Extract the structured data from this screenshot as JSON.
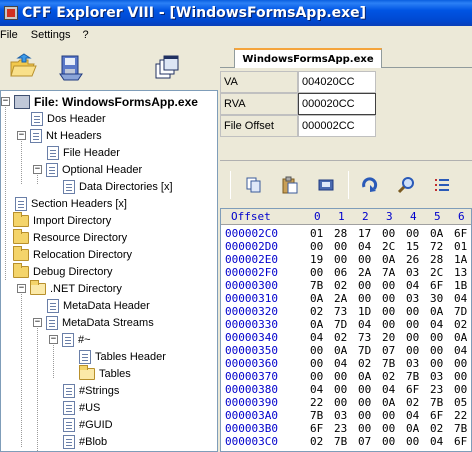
{
  "window": {
    "title": "CFF Explorer VIII - [WindowsFormsApp.exe]"
  },
  "menu": {
    "items": [
      "File",
      "Settings",
      "?"
    ]
  },
  "tab": {
    "label": "WindowsFormsApp.exe"
  },
  "info": {
    "rows": [
      {
        "label": "VA",
        "value": "004020CC"
      },
      {
        "label": "RVA",
        "value": "000020CC"
      },
      {
        "label": "File Offset",
        "value": "000002CC"
      }
    ]
  },
  "tree": {
    "items": [
      {
        "label": "File: WindowsFormsApp.exe"
      },
      {
        "label": "Dos Header"
      },
      {
        "label": "Nt Headers"
      },
      {
        "label": "File Header"
      },
      {
        "label": "Optional Header"
      },
      {
        "label": "Data Directories [x]"
      },
      {
        "label": "Section Headers [x]"
      },
      {
        "label": "Import Directory"
      },
      {
        "label": "Resource Directory"
      },
      {
        "label": "Relocation Directory"
      },
      {
        "label": "Debug Directory"
      },
      {
        "label": ".NET Directory"
      },
      {
        "label": "MetaData Header"
      },
      {
        "label": "MetaData Streams"
      },
      {
        "label": "#~"
      },
      {
        "label": "Tables Header"
      },
      {
        "label": "Tables"
      },
      {
        "label": "#Strings"
      },
      {
        "label": "#US"
      },
      {
        "label": "#GUID"
      },
      {
        "label": "#Blob"
      }
    ]
  },
  "hex": {
    "offset_header": "Offset",
    "col_headers": [
      "0",
      "1",
      "2",
      "3",
      "4",
      "5",
      "6"
    ],
    "rows": [
      {
        "offset": "000002C0",
        "bytes": [
          "01",
          "28",
          "17",
          "00",
          "00",
          "0A",
          "6F"
        ]
      },
      {
        "offset": "000002D0",
        "bytes": [
          "00",
          "00",
          "04",
          "2C",
          "15",
          "72",
          "01"
        ]
      },
      {
        "offset": "000002E0",
        "bytes": [
          "19",
          "00",
          "00",
          "0A",
          "26",
          "28",
          "1A"
        ]
      },
      {
        "offset": "000002F0",
        "bytes": [
          "00",
          "06",
          "2A",
          "7A",
          "03",
          "2C",
          "13"
        ]
      },
      {
        "offset": "00000300",
        "bytes": [
          "7B",
          "02",
          "00",
          "00",
          "04",
          "6F",
          "1B"
        ]
      },
      {
        "offset": "00000310",
        "bytes": [
          "0A",
          "2A",
          "00",
          "00",
          "03",
          "30",
          "04"
        ]
      },
      {
        "offset": "00000320",
        "bytes": [
          "02",
          "73",
          "1D",
          "00",
          "00",
          "0A",
          "7D"
        ]
      },
      {
        "offset": "00000330",
        "bytes": [
          "0A",
          "7D",
          "04",
          "00",
          "00",
          "04",
          "02"
        ]
      },
      {
        "offset": "00000340",
        "bytes": [
          "04",
          "02",
          "73",
          "20",
          "00",
          "00",
          "0A"
        ]
      },
      {
        "offset": "00000350",
        "bytes": [
          "00",
          "0A",
          "7D",
          "07",
          "00",
          "00",
          "04"
        ]
      },
      {
        "offset": "00000360",
        "bytes": [
          "00",
          "04",
          "02",
          "7B",
          "03",
          "00",
          "00"
        ]
      },
      {
        "offset": "00000370",
        "bytes": [
          "00",
          "00",
          "0A",
          "02",
          "7B",
          "03",
          "00"
        ]
      },
      {
        "offset": "00000380",
        "bytes": [
          "04",
          "00",
          "00",
          "04",
          "6F",
          "23",
          "00"
        ]
      },
      {
        "offset": "00000390",
        "bytes": [
          "22",
          "00",
          "00",
          "0A",
          "02",
          "7B",
          "05"
        ]
      },
      {
        "offset": "000003A0",
        "bytes": [
          "7B",
          "03",
          "00",
          "00",
          "04",
          "6F",
          "22"
        ]
      },
      {
        "offset": "000003B0",
        "bytes": [
          "6F",
          "23",
          "00",
          "00",
          "0A",
          "02",
          "7B"
        ]
      },
      {
        "offset": "000003C0",
        "bytes": [
          "02",
          "7B",
          "07",
          "00",
          "00",
          "04",
          "6F"
        ]
      }
    ]
  }
}
